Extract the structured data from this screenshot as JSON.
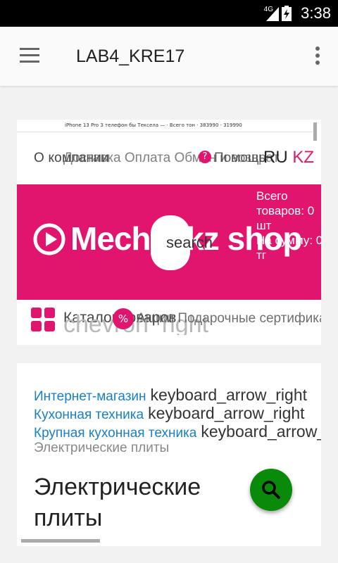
{
  "status_bar": {
    "network": "4G",
    "time": "3:38"
  },
  "appbar": {
    "title": "LAB4_KRE17"
  },
  "web": {
    "mini_strip_text": "iPhone 13 Pro 3 телефон бы Тексела — · Всего тон · 383990 · 319990",
    "top_text_1": "О компании",
    "top_text_2": "Доставка Оплата Обмен и возврат",
    "top_text_3": "Помощь",
    "top_text_right_a": "RU",
    "top_text_right_b": "KZ",
    "brand": "Mechta.kz shop",
    "search_label": "search",
    "cart_total_items": "Всего товаров: 0 шт",
    "cart_total_sum": "На сумму: 0 тг",
    "category_label": "Каталог товаров",
    "chevron_label": "chevron_right",
    "promo_label": "Акции Подарочные сертификаты"
  },
  "breadcrumbs": {
    "items": [
      {
        "label": "Интернет-магазин",
        "arrow": "keyboard_arrow_right"
      },
      {
        "label": "Кухонная техника",
        "arrow": "keyboard_arrow_right"
      },
      {
        "label": "Крупная кухонная техника",
        "arrow": "keyboard_arrow_right"
      }
    ],
    "current": "Электрические плиты",
    "page_title": "Электрические плиты"
  },
  "colors": {
    "brand_pink": "#e2156e",
    "link_blue": "#1a7fc4",
    "fab_green": "#0a8a0a"
  }
}
